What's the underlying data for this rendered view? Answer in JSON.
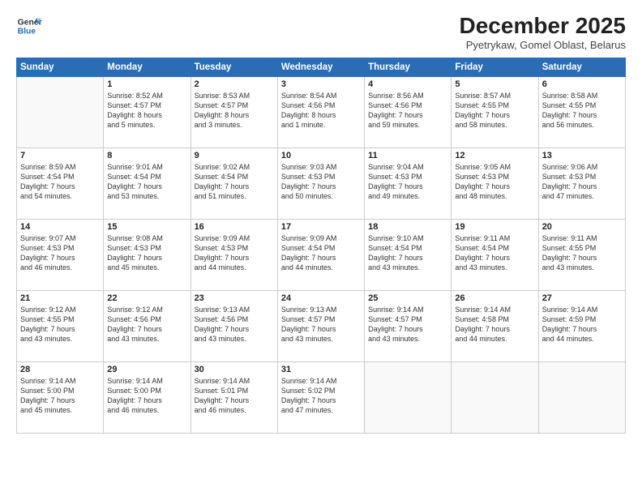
{
  "header": {
    "logo_line1": "General",
    "logo_line2": "Blue",
    "month_title": "December 2025",
    "location": "Pyetrykaw, Gomel Oblast, Belarus"
  },
  "days_of_week": [
    "Sunday",
    "Monday",
    "Tuesday",
    "Wednesday",
    "Thursday",
    "Friday",
    "Saturday"
  ],
  "weeks": [
    [
      {
        "day": "",
        "info": ""
      },
      {
        "day": "1",
        "info": "Sunrise: 8:52 AM\nSunset: 4:57 PM\nDaylight: 8 hours\nand 5 minutes."
      },
      {
        "day": "2",
        "info": "Sunrise: 8:53 AM\nSunset: 4:57 PM\nDaylight: 8 hours\nand 3 minutes."
      },
      {
        "day": "3",
        "info": "Sunrise: 8:54 AM\nSunset: 4:56 PM\nDaylight: 8 hours\nand 1 minute."
      },
      {
        "day": "4",
        "info": "Sunrise: 8:56 AM\nSunset: 4:56 PM\nDaylight: 7 hours\nand 59 minutes."
      },
      {
        "day": "5",
        "info": "Sunrise: 8:57 AM\nSunset: 4:55 PM\nDaylight: 7 hours\nand 58 minutes."
      },
      {
        "day": "6",
        "info": "Sunrise: 8:58 AM\nSunset: 4:55 PM\nDaylight: 7 hours\nand 56 minutes."
      }
    ],
    [
      {
        "day": "7",
        "info": "Sunrise: 8:59 AM\nSunset: 4:54 PM\nDaylight: 7 hours\nand 54 minutes."
      },
      {
        "day": "8",
        "info": "Sunrise: 9:01 AM\nSunset: 4:54 PM\nDaylight: 7 hours\nand 53 minutes."
      },
      {
        "day": "9",
        "info": "Sunrise: 9:02 AM\nSunset: 4:54 PM\nDaylight: 7 hours\nand 51 minutes."
      },
      {
        "day": "10",
        "info": "Sunrise: 9:03 AM\nSunset: 4:53 PM\nDaylight: 7 hours\nand 50 minutes."
      },
      {
        "day": "11",
        "info": "Sunrise: 9:04 AM\nSunset: 4:53 PM\nDaylight: 7 hours\nand 49 minutes."
      },
      {
        "day": "12",
        "info": "Sunrise: 9:05 AM\nSunset: 4:53 PM\nDaylight: 7 hours\nand 48 minutes."
      },
      {
        "day": "13",
        "info": "Sunrise: 9:06 AM\nSunset: 4:53 PM\nDaylight: 7 hours\nand 47 minutes."
      }
    ],
    [
      {
        "day": "14",
        "info": "Sunrise: 9:07 AM\nSunset: 4:53 PM\nDaylight: 7 hours\nand 46 minutes."
      },
      {
        "day": "15",
        "info": "Sunrise: 9:08 AM\nSunset: 4:53 PM\nDaylight: 7 hours\nand 45 minutes."
      },
      {
        "day": "16",
        "info": "Sunrise: 9:09 AM\nSunset: 4:53 PM\nDaylight: 7 hours\nand 44 minutes."
      },
      {
        "day": "17",
        "info": "Sunrise: 9:09 AM\nSunset: 4:54 PM\nDaylight: 7 hours\nand 44 minutes."
      },
      {
        "day": "18",
        "info": "Sunrise: 9:10 AM\nSunset: 4:54 PM\nDaylight: 7 hours\nand 43 minutes."
      },
      {
        "day": "19",
        "info": "Sunrise: 9:11 AM\nSunset: 4:54 PM\nDaylight: 7 hours\nand 43 minutes."
      },
      {
        "day": "20",
        "info": "Sunrise: 9:11 AM\nSunset: 4:55 PM\nDaylight: 7 hours\nand 43 minutes."
      }
    ],
    [
      {
        "day": "21",
        "info": "Sunrise: 9:12 AM\nSunset: 4:55 PM\nDaylight: 7 hours\nand 43 minutes."
      },
      {
        "day": "22",
        "info": "Sunrise: 9:12 AM\nSunset: 4:56 PM\nDaylight: 7 hours\nand 43 minutes."
      },
      {
        "day": "23",
        "info": "Sunrise: 9:13 AM\nSunset: 4:56 PM\nDaylight: 7 hours\nand 43 minutes."
      },
      {
        "day": "24",
        "info": "Sunrise: 9:13 AM\nSunset: 4:57 PM\nDaylight: 7 hours\nand 43 minutes."
      },
      {
        "day": "25",
        "info": "Sunrise: 9:14 AM\nSunset: 4:57 PM\nDaylight: 7 hours\nand 43 minutes."
      },
      {
        "day": "26",
        "info": "Sunrise: 9:14 AM\nSunset: 4:58 PM\nDaylight: 7 hours\nand 44 minutes."
      },
      {
        "day": "27",
        "info": "Sunrise: 9:14 AM\nSunset: 4:59 PM\nDaylight: 7 hours\nand 44 minutes."
      }
    ],
    [
      {
        "day": "28",
        "info": "Sunrise: 9:14 AM\nSunset: 5:00 PM\nDaylight: 7 hours\nand 45 minutes."
      },
      {
        "day": "29",
        "info": "Sunrise: 9:14 AM\nSunset: 5:00 PM\nDaylight: 7 hours\nand 46 minutes."
      },
      {
        "day": "30",
        "info": "Sunrise: 9:14 AM\nSunset: 5:01 PM\nDaylight: 7 hours\nand 46 minutes."
      },
      {
        "day": "31",
        "info": "Sunrise: 9:14 AM\nSunset: 5:02 PM\nDaylight: 7 hours\nand 47 minutes."
      },
      {
        "day": "",
        "info": ""
      },
      {
        "day": "",
        "info": ""
      },
      {
        "day": "",
        "info": ""
      }
    ]
  ]
}
